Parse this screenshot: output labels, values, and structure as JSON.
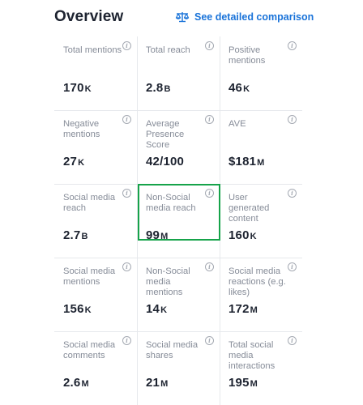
{
  "header": {
    "title": "Overview",
    "compare_link": "See detailed comparison",
    "compare_icon": "scale-icon",
    "accent_color": "#1a73d9"
  },
  "metrics": [
    {
      "label": "Total mentions",
      "value": "170",
      "unit": "K"
    },
    {
      "label": "Total reach",
      "value": "2.8",
      "unit": "B"
    },
    {
      "label": "Positive mentions",
      "value": "46",
      "unit": "K"
    },
    {
      "label": "Negative mentions",
      "value": "27",
      "unit": "K"
    },
    {
      "label": "Average Presence Score",
      "value": "42/100",
      "unit": ""
    },
    {
      "label": "AVE",
      "value": "$181",
      "unit": "M"
    },
    {
      "label": "Social media reach",
      "value": "2.7",
      "unit": "B"
    },
    {
      "label": "Non-Social media reach",
      "value": "99",
      "unit": "M",
      "highlighted": true
    },
    {
      "label": "User generated content",
      "value": "160",
      "unit": "K"
    },
    {
      "label": "Social media mentions",
      "value": "156",
      "unit": "K"
    },
    {
      "label": "Non-Social media mentions",
      "value": "14",
      "unit": "K"
    },
    {
      "label": "Social media reactions (e.g. likes)",
      "value": "172",
      "unit": "M"
    },
    {
      "label": "Social media comments",
      "value": "2.6",
      "unit": "M"
    },
    {
      "label": "Social media shares",
      "value": "21",
      "unit": "M"
    },
    {
      "label": "Total social media interactions",
      "value": "195",
      "unit": "M"
    }
  ],
  "info_icon": "info-icon",
  "highlight_color": "#16a34a"
}
